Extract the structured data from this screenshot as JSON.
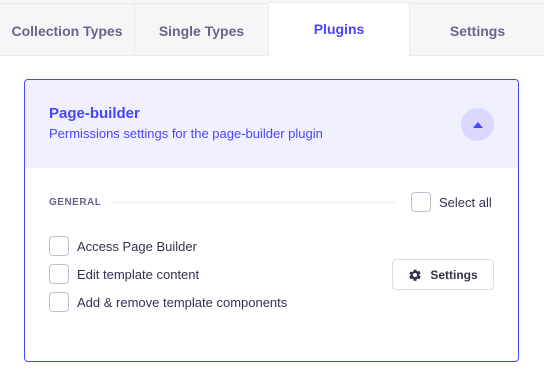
{
  "tabs": [
    {
      "label": "Collection Types"
    },
    {
      "label": "Single Types"
    },
    {
      "label": "Plugins"
    },
    {
      "label": "Settings"
    }
  ],
  "active_tab": "Plugins",
  "plugin": {
    "title": "Page-builder",
    "subtitle": "Permissions settings for the page-builder plugin",
    "section_label": "GENERAL",
    "select_all_label": "Select all",
    "permissions": [
      {
        "label": "Access Page Builder",
        "checked": false
      },
      {
        "label": "Edit template content",
        "checked": false
      },
      {
        "label": "Add & remove template components",
        "checked": false
      }
    ],
    "settings_button_label": "Settings"
  },
  "icons": {
    "collapse": "chevron-up-icon",
    "settings": "gear-icon"
  },
  "colors": {
    "accent": "#4945ff",
    "header_bg": "#f0f0ff",
    "collapse_bg": "#d9d8ff"
  }
}
